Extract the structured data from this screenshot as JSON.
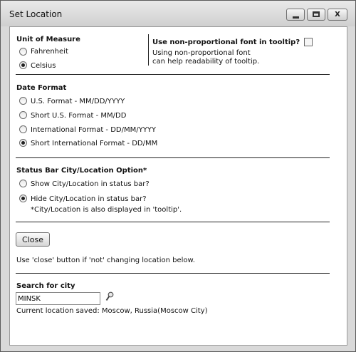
{
  "window": {
    "title": "Set Location",
    "buttons": {
      "minimize": "minimize",
      "maximize": "maximize",
      "close": "X"
    }
  },
  "unit_of_measure": {
    "heading": "Unit of Measure",
    "options": [
      {
        "label": "Fahrenheit",
        "selected": false
      },
      {
        "label": "Celsius",
        "selected": true
      }
    ]
  },
  "tooltip_font": {
    "label": "Use non-proportional font in tooltip?",
    "checked": false,
    "help_line1": "Using non-proportional font",
    "help_line2": "can help readability of tooltip."
  },
  "date_format": {
    "heading": "Date Format",
    "options": [
      {
        "label": "U.S. Format - MM/DD/YYYY",
        "selected": false
      },
      {
        "label": "Short U.S. Format - MM/DD",
        "selected": false
      },
      {
        "label": "International Format - DD/MM/YYYY",
        "selected": false
      },
      {
        "label": "Short International Format - DD/MM",
        "selected": true
      }
    ]
  },
  "status_bar": {
    "heading": "Status Bar City/Location Option*",
    "options": [
      {
        "label": "Show City/Location in status bar?",
        "selected": false
      },
      {
        "label": "Hide City/Location in status bar?",
        "selected": true
      }
    ],
    "footnote": "*City/Location is also displayed in 'tooltip'."
  },
  "close_section": {
    "button_label": "Close",
    "hint": "Use 'close' button if 'not' changing location below."
  },
  "search": {
    "heading": "Search for city",
    "value": "MINSK",
    "icon": "magnifier-icon",
    "current_location": "Current location saved: Moscow, Russia(Moscow City)"
  }
}
